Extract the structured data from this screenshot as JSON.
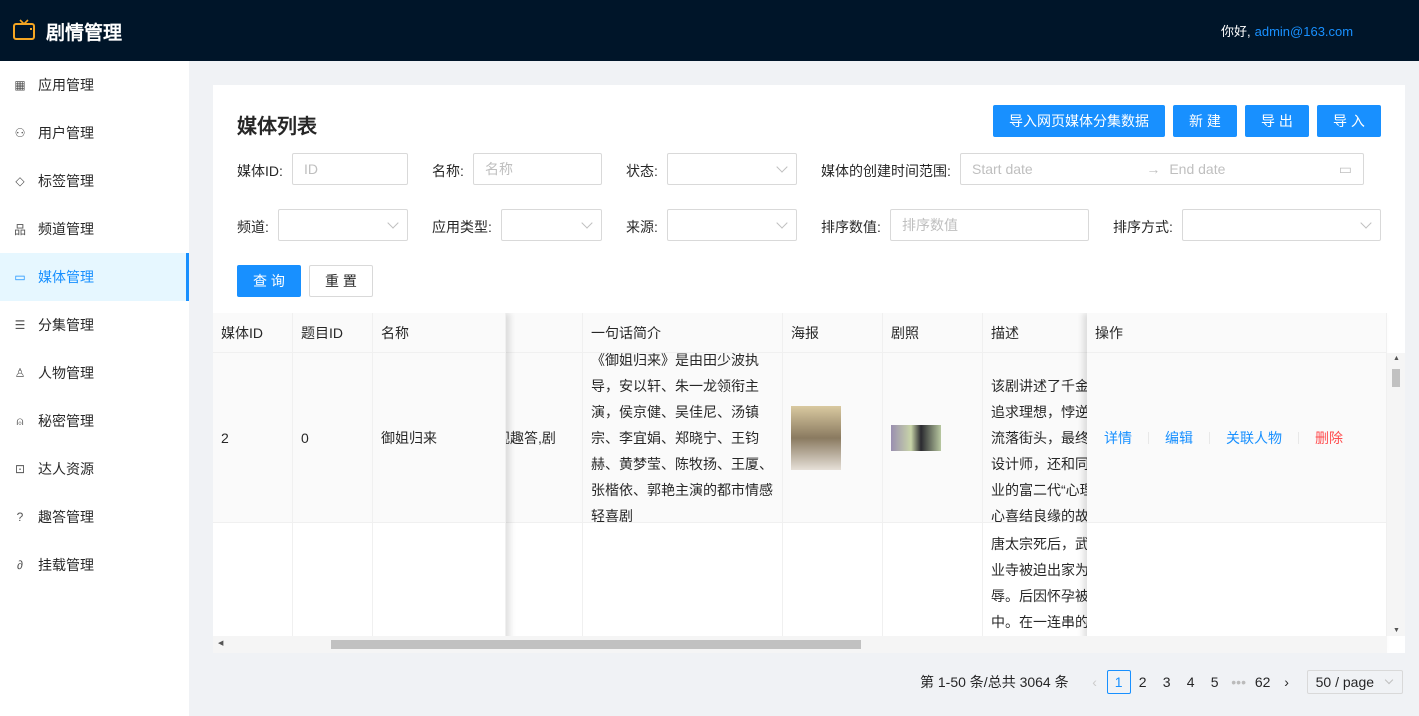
{
  "header": {
    "title": "剧情管理",
    "greeting": "你好,",
    "user": "admin@163.com"
  },
  "sidebar": {
    "items": [
      {
        "label": "应用管理",
        "icon": "grid-icon"
      },
      {
        "label": "用户管理",
        "icon": "users-icon"
      },
      {
        "label": "标签管理",
        "icon": "tag-icon"
      },
      {
        "label": "频道管理",
        "icon": "cluster-icon"
      },
      {
        "label": "媒体管理",
        "icon": "media-icon",
        "active": true
      },
      {
        "label": "分集管理",
        "icon": "list-icon"
      },
      {
        "label": "人物管理",
        "icon": "user-add-icon"
      },
      {
        "label": "秘密管理",
        "icon": "alert-icon"
      },
      {
        "label": "达人资源",
        "icon": "presentation-icon"
      },
      {
        "label": "趣答管理",
        "icon": "question-icon"
      },
      {
        "label": "挂载管理",
        "icon": "paperclip-icon"
      }
    ]
  },
  "page": {
    "title": "媒体列表",
    "buttons": {
      "import_web": "导入网页媒体分集数据",
      "new": "新 建",
      "export": "导 出",
      "import": "导 入",
      "query": "查 询",
      "reset": "重 置"
    },
    "filters": {
      "media_id_label": "媒体ID:",
      "media_id_placeholder": "ID",
      "name_label": "名称:",
      "name_placeholder": "名称",
      "status_label": "状态:",
      "date_label": "媒体的创建时间范围:",
      "start_placeholder": "Start date",
      "end_placeholder": "End date",
      "channel_label": "频道:",
      "app_type_label": "应用类型:",
      "source_label": "来源:",
      "sort_value_label": "排序数值:",
      "sort_value_placeholder": "排序数值",
      "sort_method_label": "排序方式:"
    }
  },
  "table": {
    "headers": [
      "媒体ID",
      "题目ID",
      "名称",
      "",
      "一句话简介",
      "海报",
      "剧照",
      "描述",
      "操作"
    ],
    "rows": [
      {
        "media_id": "2",
        "question_id": "0",
        "name": "御姐归来",
        "partial": "视趣答,剧",
        "summary": "《御姐归来》是由田少波执导，安以轩、朱一龙领衔主演，侯京健、吴佳尼、汤镇宗、李宜娟、郑晓宁、王钧赫、黄梦莹、陈牧扬、王厦、张楷依、郭艳主演的都市情感轻喜剧",
        "description": "该剧讲述了千金追求理想，悖逆流落街头，最终设计师，还和同业的富二代“心理心喜结良缘的故"
      },
      {
        "media_id": "",
        "question_id": "",
        "name": "",
        "partial": "",
        "summary": "",
        "description": "唐太宗死后，武业寺被迫出家为辱。后因怀孕被中。在一连串的武媚娘亲手扼杀"
      }
    ],
    "actions": {
      "detail": "详情",
      "edit": "编辑",
      "related": "关联人物",
      "delete": "删除"
    }
  },
  "pagination": {
    "summary": "第 1-50 条/总共 3064 条",
    "pages": [
      "1",
      "2",
      "3",
      "4",
      "5",
      "•••",
      "62"
    ],
    "current": "1",
    "page_size": "50 / page"
  }
}
